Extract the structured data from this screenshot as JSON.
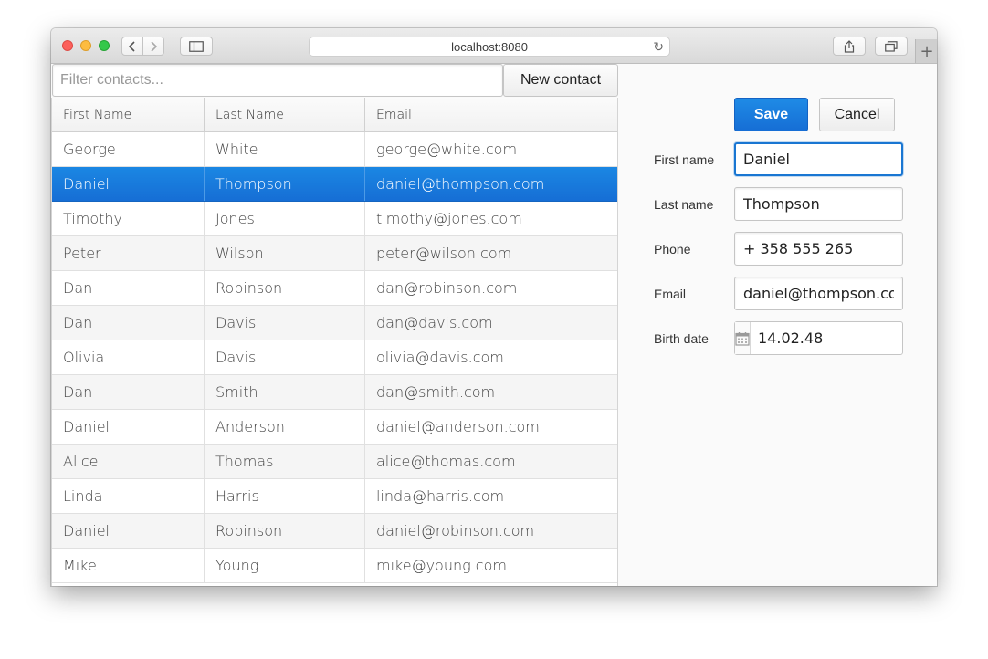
{
  "browser": {
    "url": "localhost:8080"
  },
  "toolbar": {
    "filter_placeholder": "Filter contacts...",
    "new_contact_label": "New contact"
  },
  "grid": {
    "columns": [
      "First Name",
      "Last Name",
      "Email"
    ],
    "rows": [
      {
        "first": "George",
        "last": "White",
        "email": "george@white.com"
      },
      {
        "first": "Daniel",
        "last": "Thompson",
        "email": "daniel@thompson.com"
      },
      {
        "first": "Timothy",
        "last": "Jones",
        "email": "timothy@jones.com"
      },
      {
        "first": "Peter",
        "last": "Wilson",
        "email": "peter@wilson.com"
      },
      {
        "first": "Dan",
        "last": "Robinson",
        "email": "dan@robinson.com"
      },
      {
        "first": "Dan",
        "last": "Davis",
        "email": "dan@davis.com"
      },
      {
        "first": "Olivia",
        "last": "Davis",
        "email": "olivia@davis.com"
      },
      {
        "first": "Dan",
        "last": "Smith",
        "email": "dan@smith.com"
      },
      {
        "first": "Daniel",
        "last": "Anderson",
        "email": "daniel@anderson.com"
      },
      {
        "first": "Alice",
        "last": "Thomas",
        "email": "alice@thomas.com"
      },
      {
        "first": "Linda",
        "last": "Harris",
        "email": "linda@harris.com"
      },
      {
        "first": "Daniel",
        "last": "Robinson",
        "email": "daniel@robinson.com"
      },
      {
        "first": "Mike",
        "last": "Young",
        "email": "mike@young.com"
      }
    ],
    "selected_index": 1
  },
  "form": {
    "save_label": "Save",
    "cancel_label": "Cancel",
    "first_name": {
      "label": "First name",
      "value": "Daniel"
    },
    "last_name": {
      "label": "Last name",
      "value": "Thompson"
    },
    "phone": {
      "label": "Phone",
      "value": "+ 358 555 265"
    },
    "email": {
      "label": "Email",
      "value": "daniel@thompson.com"
    },
    "birth_date": {
      "label": "Birth date",
      "value": "14.02.48"
    }
  },
  "colors": {
    "accent": "#166ed5",
    "selection": "#1b87e3"
  },
  "icons": {
    "back": "chevron-left-icon",
    "forward": "chevron-right-icon",
    "sidebar": "sidebar-icon",
    "reload": "reload-icon",
    "share": "share-icon",
    "tabs": "tabs-icon",
    "calendar": "calendar-icon"
  }
}
